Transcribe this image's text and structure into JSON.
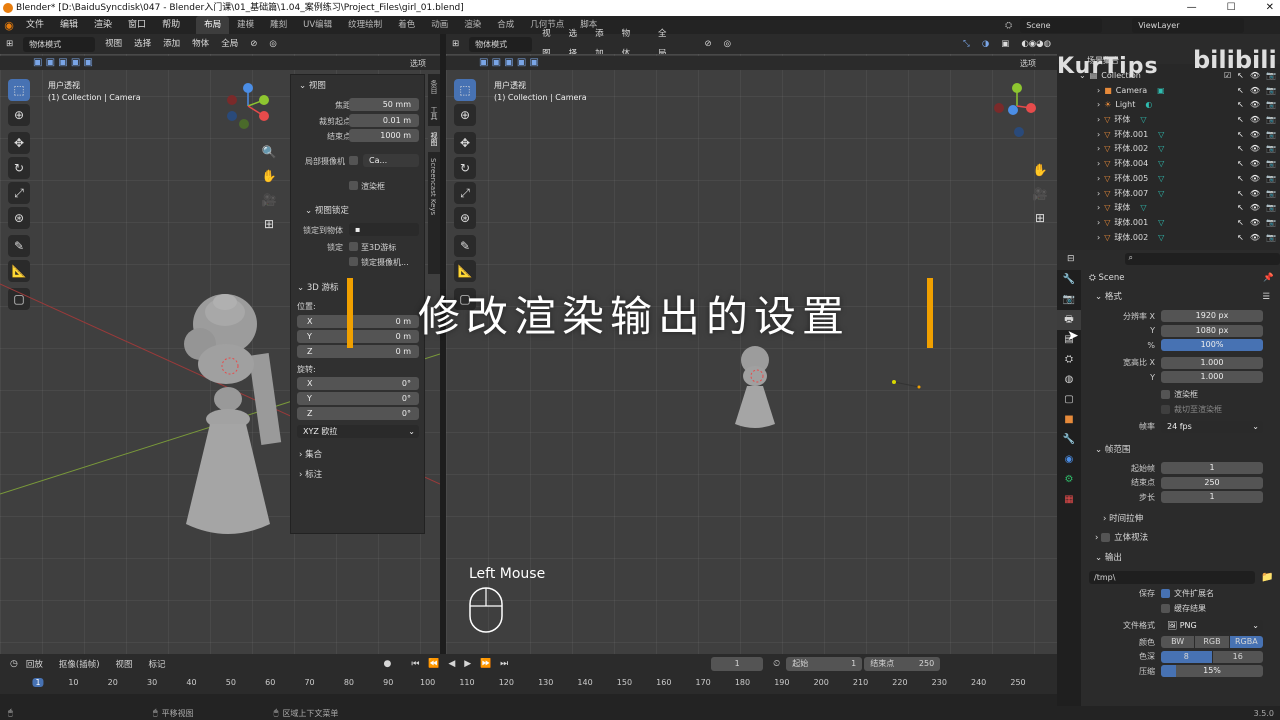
{
  "window": {
    "title": "Blender* [D:\\BaiduSyncdisk\\047 - Blender入门课\\01_基础篇\\1.04_案例练习\\Project_Files\\girl_01.blend]"
  },
  "menubar": {
    "menus": [
      "文件",
      "编辑",
      "渲染",
      "窗口",
      "帮助"
    ],
    "workspaces": [
      "布局",
      "建模",
      "雕刻",
      "UV编辑",
      "纹理绘制",
      "着色",
      "动画",
      "渲染",
      "合成",
      "几何节点",
      "脚本"
    ],
    "active_workspace": "布局",
    "scene": "Scene",
    "view_layer": "ViewLayer"
  },
  "left_viewport": {
    "mode": "物体模式",
    "menus": [
      "视图",
      "选择",
      "添加",
      "物体"
    ],
    "orientation": "全局",
    "options": "选项",
    "view_name": "用户透视",
    "collection_info": "(1) Collection | Camera",
    "npanel": {
      "view_section": "视图",
      "focal_label": "焦距",
      "focal_value": "50 mm",
      "clip_start_label": "裁剪起点",
      "clip_start_value": "0.01 m",
      "clip_end_label": "结束点",
      "clip_end_value": "1000 m",
      "local_camera_label": "局部摄像机",
      "local_camera_value": "Ca...",
      "render_region": "渲染框",
      "view_lock_section": "视图锁定",
      "lock_to_object": "锁定到物体",
      "lock_label": "锁定",
      "lock_to_cursor": "至3D游标",
      "lock_camera": "锁定摄像机...",
      "cursor_section": "3D 游标",
      "location_label": "位置:",
      "loc_x": "0 m",
      "loc_y": "0 m",
      "loc_z": "0 m",
      "rotation_label": "旋转:",
      "rot_x": "0°",
      "rot_y": "0°",
      "rot_z": "0°",
      "rot_mode": "XYZ 欧拉",
      "collections": "集合",
      "annotations": "标注",
      "axis_x": "X",
      "axis_y": "Y",
      "axis_z": "Z",
      "tabs": [
        "条目",
        "工具",
        "视图",
        "Screencast Keys"
      ]
    }
  },
  "right_viewport": {
    "mode": "物体模式",
    "menus": [
      "视图",
      "选择",
      "添加",
      "物体"
    ],
    "orientation": "全局",
    "options": "选项",
    "view_name": "用户透视",
    "collection_info": "(1) Collection | Camera"
  },
  "overlay": {
    "caption": "修改渲染输出的设置",
    "watermark": "KurTips",
    "left_mouse": "Left Mouse"
  },
  "outliner": {
    "root": "场景集合",
    "collection": "Collection",
    "items": [
      "Camera",
      "Light",
      "环体",
      "环体.001",
      "环体.002",
      "环体.004",
      "环体.005",
      "环体.007",
      "球体",
      "球体.001",
      "球体.002"
    ]
  },
  "properties": {
    "scene_name": "Scene",
    "format_section": "格式",
    "res_x_label": "分辨率 X",
    "res_x": "1920 px",
    "res_y_label": "Y",
    "res_y": "1080 px",
    "res_pct_label": "%",
    "res_pct": "100%",
    "aspect_x_label": "宽高比 X",
    "aspect_x": "1.000",
    "aspect_y_label": "Y",
    "aspect_y": "1.000",
    "render_region": "渲染框",
    "crop_to_region": "裁切至渲染框",
    "fps_label": "帧率",
    "fps": "24 fps",
    "frame_range_section": "帧范围",
    "frame_start_label": "起始帧",
    "frame_start": "1",
    "frame_end_label": "结束点",
    "frame_end": "250",
    "frame_step_label": "步长",
    "frame_step": "1",
    "time_stretch": "时间拉伸",
    "stereoscopy": "立体视法",
    "output_section": "输出",
    "output_path": "/tmp\\",
    "save_label": "保存",
    "file_ext": "文件扩展名",
    "cache_result": "缓存结果",
    "file_format_label": "文件格式",
    "file_format": "PNG",
    "color_label": "颜色",
    "color_options": [
      "BW",
      "RGB",
      "RGBA"
    ],
    "color_selected": "RGBA",
    "depth_label": "色深",
    "depth_options": [
      "8",
      "16"
    ],
    "depth_selected": "8",
    "compression_label": "压缩",
    "compression": "15%"
  },
  "timeline": {
    "menus": [
      "回放",
      "抠像(插帧)",
      "视图",
      "标记"
    ],
    "current_frame": "1",
    "start_label": "起始",
    "start": "1",
    "end_label": "结束点",
    "end": "250",
    "ticks": [
      "1",
      "10",
      "20",
      "30",
      "40",
      "50",
      "60",
      "70",
      "80",
      "90",
      "100",
      "110",
      "120",
      "130",
      "140",
      "150",
      "160",
      "170",
      "180",
      "190",
      "200",
      "210",
      "220",
      "230",
      "240",
      "250"
    ]
  },
  "statusbar": {
    "pan": "平移视图",
    "context_menu": "区域上下文菜单",
    "version": "3.5.0"
  },
  "colors": {
    "accent_blue": "#4772b3",
    "orange": "#f0a000",
    "viewport_bg": "#3f3f3f"
  }
}
